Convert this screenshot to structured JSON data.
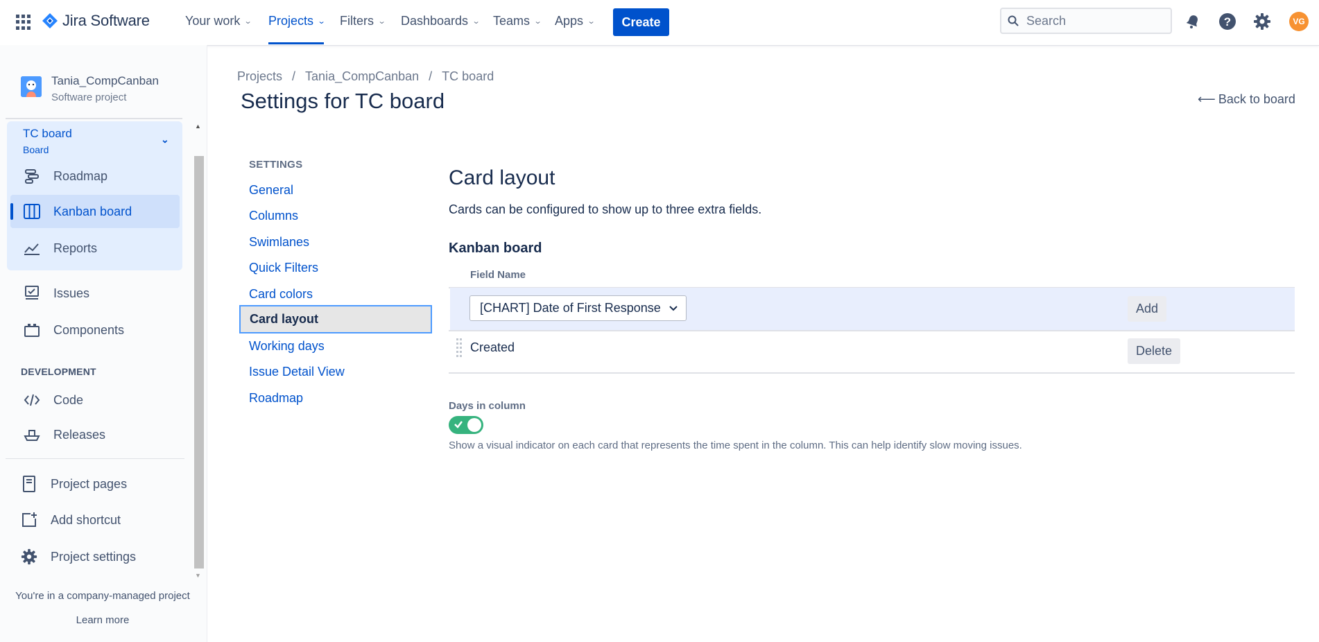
{
  "topnav": {
    "product": "Jira Software",
    "items": [
      {
        "label": "Your work",
        "active": false
      },
      {
        "label": "Projects",
        "active": true
      },
      {
        "label": "Filters",
        "active": false
      },
      {
        "label": "Dashboards",
        "active": false
      },
      {
        "label": "Teams",
        "active": false
      },
      {
        "label": "Apps",
        "active": false
      }
    ],
    "create_label": "Create",
    "search_placeholder": "Search",
    "avatar_initials": "VG"
  },
  "sidebar": {
    "project_name": "Tania_CompCanban",
    "project_type": "Software project",
    "board_title": "TC board",
    "board_subtitle": "Board",
    "board_items": [
      {
        "label": "Roadmap",
        "icon": "roadmap-icon"
      },
      {
        "label": "Kanban board",
        "icon": "board-icon",
        "active": true
      },
      {
        "label": "Reports",
        "icon": "reports-icon"
      }
    ],
    "items": [
      {
        "label": "Issues",
        "icon": "issues-icon"
      },
      {
        "label": "Components",
        "icon": "components-icon"
      }
    ],
    "dev_section": "DEVELOPMENT",
    "dev_items": [
      {
        "label": "Code",
        "icon": "code-icon"
      },
      {
        "label": "Releases",
        "icon": "releases-icon"
      }
    ],
    "bottom_items": [
      {
        "label": "Project pages",
        "icon": "pages-icon"
      },
      {
        "label": "Add shortcut",
        "icon": "add-shortcut-icon"
      },
      {
        "label": "Project settings",
        "icon": "settings-icon"
      }
    ],
    "footer_text": "You're in a company-managed project",
    "footer_link": "Learn more"
  },
  "breadcrumb": [
    "Projects",
    "Tania_CompCanban",
    "TC board"
  ],
  "page_title": "Settings for TC board",
  "back_link": "Back to board",
  "settings_nav": {
    "heading": "SETTINGS",
    "items": [
      "General",
      "Columns",
      "Swimlanes",
      "Quick Filters",
      "Card colors",
      "Card layout",
      "Working days",
      "Issue Detail View",
      "Roadmap"
    ],
    "active": "Card layout"
  },
  "card_layout": {
    "title": "Card layout",
    "description": "Cards can be configured to show up to three extra fields.",
    "board_heading": "Kanban board",
    "column_header": "Field Name",
    "select_value": "[CHART] Date of First Response",
    "add_label": "Add",
    "fields": [
      {
        "name": "Created",
        "action": "Delete"
      }
    ],
    "days_in_column": {
      "label": "Days in column",
      "enabled": true,
      "description": "Show a visual indicator on each card that represents the time spent in the column. This can help identify slow moving issues."
    }
  },
  "colors": {
    "accent": "#0052cc",
    "toggle_on": "#36b37e",
    "avatar": "#f79232"
  }
}
